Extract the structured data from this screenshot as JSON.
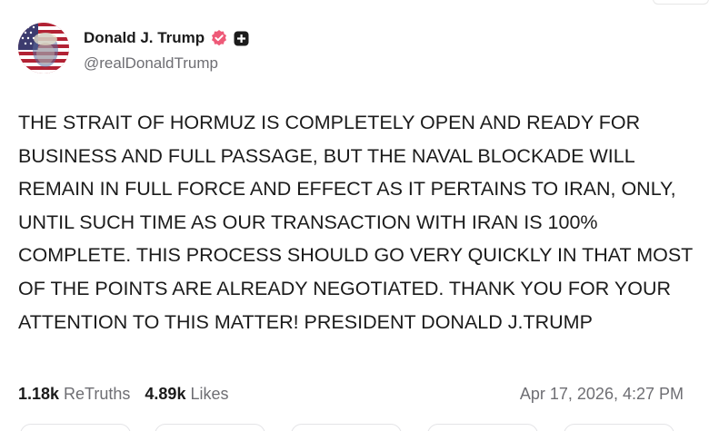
{
  "author": {
    "display_name": "Donald J. Trump",
    "handle": "@realDonaldTrump",
    "verified_icon": "verified-badge-icon",
    "plus_icon": "plus-badge-icon",
    "verified_color": "#ee5a78"
  },
  "post": {
    "text": "THE STRAIT OF HORMUZ IS COMPLETELY OPEN AND READY FOR BUSINESS AND FULL PASSAGE, BUT THE NAVAL BLOCKADE WILL REMAIN IN FULL FORCE AND EFFECT AS IT PERTAINS TO IRAN, ONLY, UNTIL SUCH TIME AS OUR TRANSACTION WITH IRAN IS 100% COMPLETE. THIS PROCESS SHOULD GO VERY QUICKLY IN THAT MOST OF THE POINTS ARE ALREADY NEGOTIATED. THANK YOU FOR YOUR ATTENTION TO THIS MATTER! PRESIDENT DONALD J.TRUMP",
    "timestamp": "Apr 17, 2026, 4:27 PM"
  },
  "stats": {
    "retruths_count": "1.18k",
    "retruths_label": "ReTruths",
    "likes_count": "4.89k",
    "likes_label": "Likes"
  }
}
